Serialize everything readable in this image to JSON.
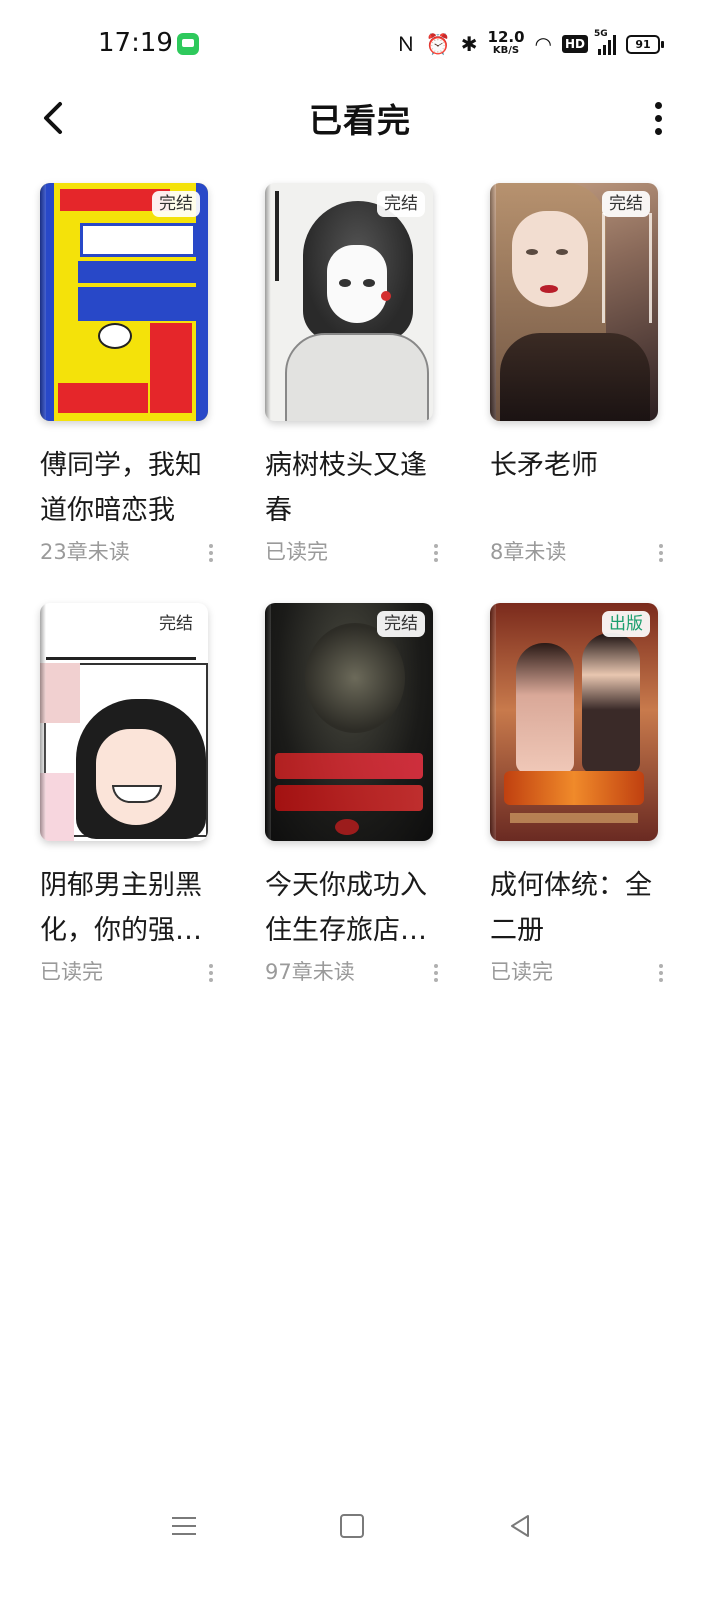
{
  "status_bar": {
    "time": "17:19",
    "net_speed_value": "12.0",
    "net_speed_unit": "KB/S",
    "hd_label": "HD",
    "signal_label": "5G",
    "battery": "91"
  },
  "header": {
    "title": "已看完"
  },
  "books": [
    {
      "title": "傅同学，我知道你暗恋我",
      "progress": "23章未读",
      "badge": "完结",
      "badge_type": "done",
      "cover": "c1"
    },
    {
      "title": "病树枝头又逢春",
      "progress": "已读完",
      "badge": "完结",
      "badge_type": "done",
      "cover": "c2"
    },
    {
      "title": "长矛老师",
      "progress": "8章未读",
      "badge": "完结",
      "badge_type": "done",
      "cover": "c3"
    },
    {
      "title": "阴郁男主别黑化，你的强…",
      "progress": "已读完",
      "badge": "完结",
      "badge_type": "done",
      "cover": "c4"
    },
    {
      "title": "今天你成功入住生存旅店…",
      "progress": "97章未读",
      "badge": "完结",
      "badge_type": "done",
      "cover": "c5"
    },
    {
      "title": "成何体统：全二册",
      "progress": "已读完",
      "badge": "出版",
      "badge_type": "published",
      "cover": "c6"
    }
  ],
  "colors": {
    "background": "#ffffff",
    "text_primary": "#1a1a1a",
    "text_secondary": "#9a9a9a",
    "published_badge": "#1a9e6e"
  }
}
